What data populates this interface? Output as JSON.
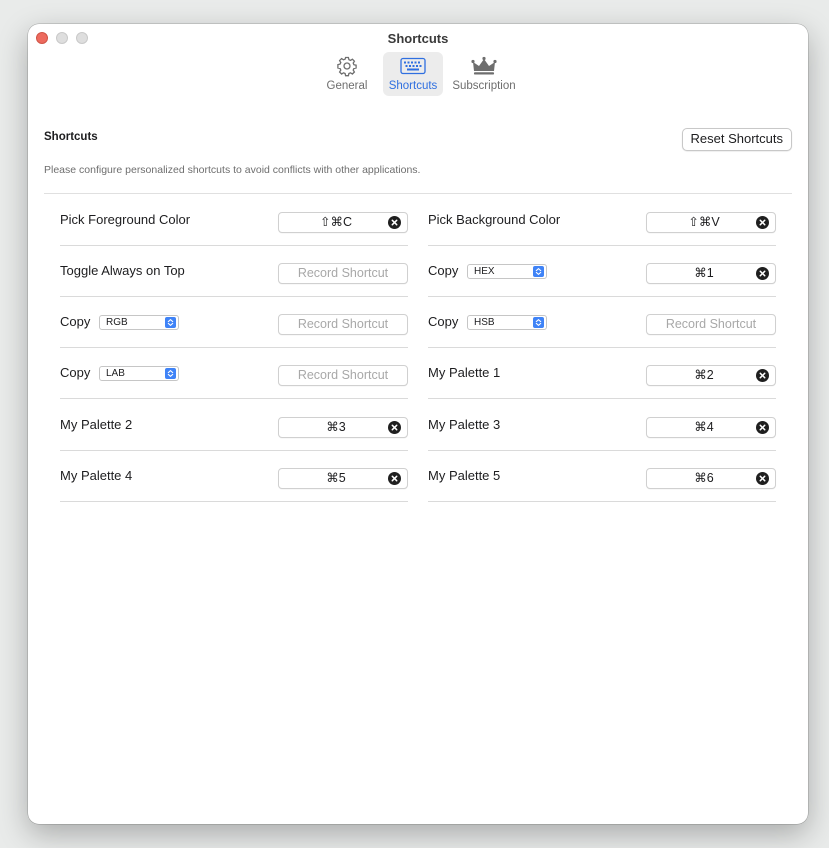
{
  "window": {
    "title": "Shortcuts"
  },
  "tabs": [
    {
      "label": "General",
      "icon": "gear-icon"
    },
    {
      "label": "Shortcuts",
      "icon": "keyboard-icon",
      "active": true
    },
    {
      "label": "Subscription",
      "icon": "crown-icon"
    }
  ],
  "section": {
    "title": "Shortcuts",
    "reset_label": "Reset Shortcuts",
    "description": "Please configure personalized shortcuts to avoid conflicts with other applications."
  },
  "colors": {
    "accent": "#2f6fe0",
    "select_arrow": "#3f83f7",
    "close_button": "#ed6a5e"
  },
  "rows": [
    {
      "label": "Pick Foreground Color",
      "shortcut": "⇧⌘C"
    },
    {
      "label": "Pick Background Color",
      "shortcut": "⇧⌘V"
    },
    {
      "label": "Toggle Always on Top",
      "placeholder": "Record Shortcut"
    },
    {
      "label": "Copy",
      "format": "HEX",
      "shortcut": "⌘1"
    },
    {
      "label": "Copy",
      "format": "RGB",
      "placeholder": "Record Shortcut"
    },
    {
      "label": "Copy",
      "format": "HSB",
      "placeholder": "Record Shortcut"
    },
    {
      "label": "Copy",
      "format": "LAB",
      "placeholder": "Record Shortcut"
    },
    {
      "label": "My Palette 1",
      "shortcut": "⌘2"
    },
    {
      "label": "My Palette 2",
      "shortcut": "⌘3"
    },
    {
      "label": "My Palette 3",
      "shortcut": "⌘4"
    },
    {
      "label": "My Palette 4",
      "shortcut": "⌘5"
    },
    {
      "label": "My Palette 5",
      "shortcut": "⌘6"
    }
  ]
}
